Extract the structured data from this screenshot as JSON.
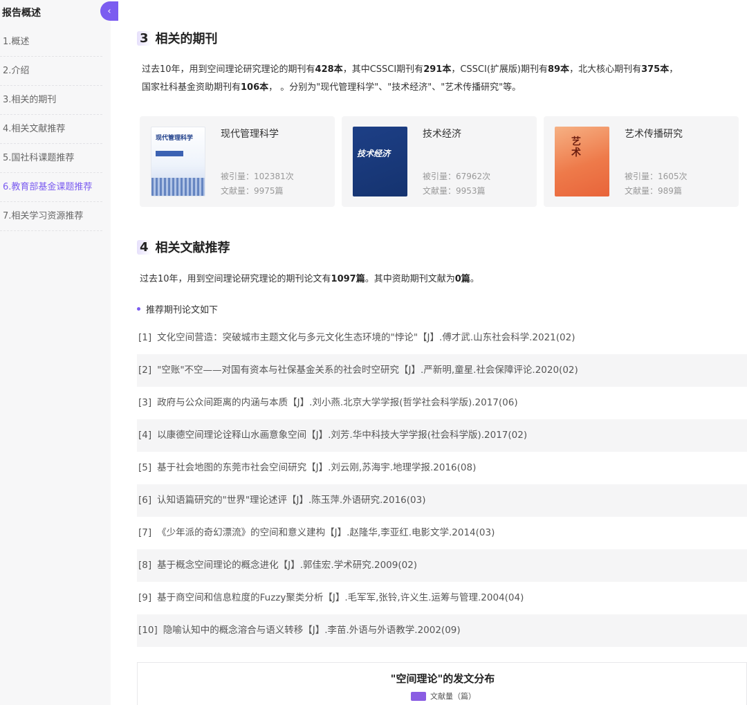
{
  "sidebar": {
    "title": "报告概述",
    "collapse_icon": "‹",
    "items": [
      {
        "label": "1.概述",
        "active": false
      },
      {
        "label": "2.介绍",
        "active": false
      },
      {
        "label": "3.相关的期刊",
        "active": false
      },
      {
        "label": "4.相关文献推荐",
        "active": false
      },
      {
        "label": "5.国社科课题推荐",
        "active": false
      },
      {
        "label": "6.教育部基金课题推荐",
        "active": true
      },
      {
        "label": "7.相关学习资源推荐",
        "active": false
      }
    ]
  },
  "section3": {
    "num": "3",
    "title": "相关的期刊",
    "p1": "过去10年，用到空间理论研究理论的期刊有",
    "n_total": "428本",
    "p2": "，其中CSSCI期刊有",
    "n_cssci": "291本",
    "p3": "，CSSCI(扩展版)期刊有",
    "n_ext": "89本",
    "p4": "，北大核心期刊有",
    "n_pku": "375本",
    "p5": "，",
    "p6": "国家社科基金资助期刊有",
    "n_nssf": "106本",
    "p7": "，  。分别为\"现代管理科学\"、\"技术经济\"、\"艺术传播研究\"等。",
    "journals": [
      {
        "name": "现代管理科学",
        "citations": "被引量：102381次",
        "docs": "文献量：9975篇",
        "cover_text": "现代管理科学"
      },
      {
        "name": "技术经济",
        "citations": "被引量：67962次",
        "docs": "文献量：9953篇",
        "cover_text": "技术经济"
      },
      {
        "name": "艺术传播研究",
        "citations": "被引量：1605次",
        "docs": "文献量：989篇",
        "cover_text": "艺术"
      }
    ]
  },
  "section4": {
    "num": "4",
    "title": "相关文献推荐",
    "p1": "过去10年，用到空间理论研究理论的期刊论文有",
    "n_papers": "1097篇",
    "p2": "。其中资助期刊文献为",
    "n_funded": "0篇",
    "p3": "。",
    "subheading": "推荐期刊论文如下",
    "refs": [
      {
        "idx": "[1]",
        "text": "文化空间营造：突破城市主题文化与多元文化生态环境的\"悖论\"【J】.傅才武.山东社会科学.2021(02)"
      },
      {
        "idx": "[2]",
        "text": "\"空账\"不空——对国有资本与社保基金关系的社会时空研究【J】.严新明,童星.社会保障评论.2020(02)"
      },
      {
        "idx": "[3]",
        "text": "政府与公众间距离的内涵与本质【J】.刘小燕.北京大学学报(哲学社会科学版).2017(06)"
      },
      {
        "idx": "[4]",
        "text": "以康德空间理论诠释山水画意象空间【J】.刘芳.华中科技大学学报(社会科学版).2017(02)"
      },
      {
        "idx": "[5]",
        "text": "基于社会地图的东莞市社会空间研究【J】.刘云刚,苏海宇.地理学报.2016(08)"
      },
      {
        "idx": "[6]",
        "text": "认知语篇研究的\"世界\"理论述评【J】.陈玉萍.外语研究.2016(03)"
      },
      {
        "idx": "[7]",
        "text": "《少年派的奇幻漂流》的空间和意义建构【J】.赵隆华,李亚红.电影文学.2014(03)"
      },
      {
        "idx": "[8]",
        "text": "基于概念空间理论的概念进化【J】.郭佳宏.学术研究.2009(02)"
      },
      {
        "idx": "[9]",
        "text": "基于商空间和信息粒度的Fuzzy聚类分析【J】.毛军军,张铃,许义生.运筹与管理.2004(04)"
      },
      {
        "idx": "[10]",
        "text": "隐喻认知中的概念溶合与语义转移【J】.李苗.外语与外语教学.2002(09)"
      }
    ]
  },
  "chart": {
    "title": "\"空间理论\"的发文分布",
    "legend_label": "文献量（篇）",
    "legend_color": "#8a5de3"
  },
  "colors": {
    "accent": "#7b5cf0",
    "sidebar_bg": "#f7f7f8",
    "card_bg": "#f5f5f6"
  }
}
